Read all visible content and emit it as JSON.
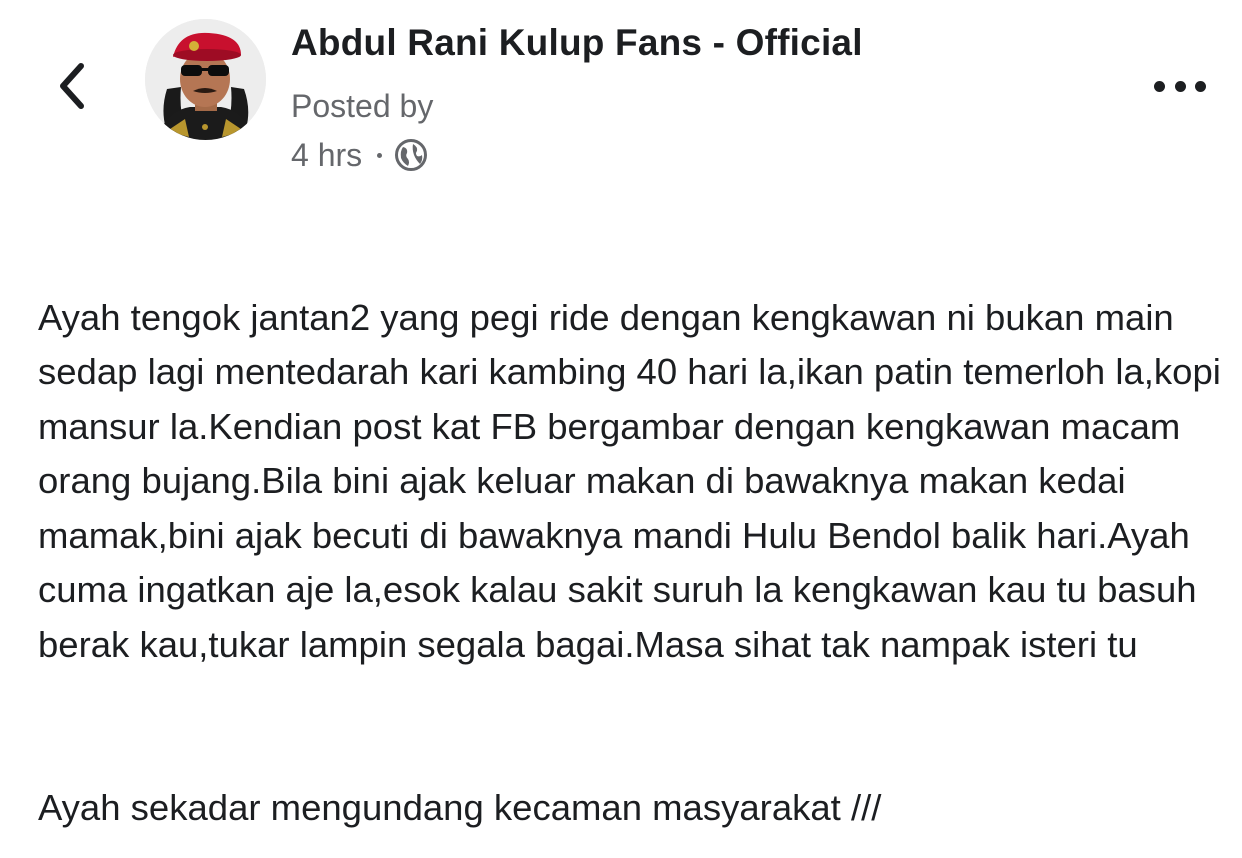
{
  "header": {
    "page_name": "Abdul Rani Kulup Fans - Official",
    "posted_by": "Posted by",
    "time": "4 hrs",
    "icons": {
      "back": "chevron-left-icon",
      "audience": "globe-icon",
      "more": "more-horizontal-icon"
    }
  },
  "post": {
    "paragraphs": [
      "Ayah tengok jantan2 yang pegi ride dengan kengkawan ni bukan main sedap lagi mentedarah kari kambing 40 hari la,ikan patin temerloh la,kopi mansur la.Kendian post kat FB bergambar dengan kengkawan macam orang bujang.Bila bini ajak keluar makan di bawaknya makan kedai mamak,bini ajak becuti di bawaknya mandi Hulu Bendol balik hari.Ayah cuma ingatkan aje la,esok kalau sakit suruh la kengkawan kau tu basuh berak kau,tukar lampin segala bagai.Masa sihat tak nampak isteri tu",
      "Ayah sekadar mengundang kecaman masyarakat ///"
    ]
  },
  "colors": {
    "text_primary": "#1c1e21",
    "text_secondary": "#65676b",
    "avatar_beret": "#c8102e",
    "background": "#ffffff"
  }
}
